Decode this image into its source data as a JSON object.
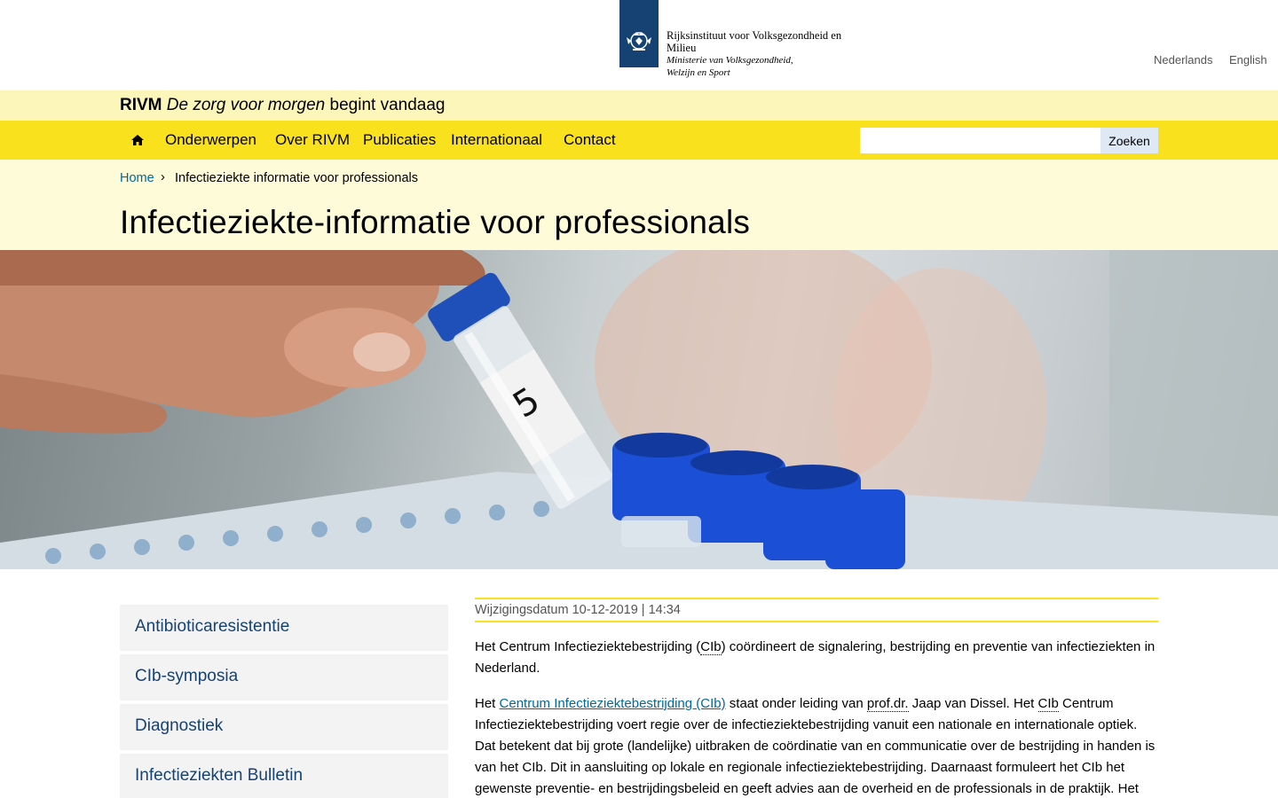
{
  "header": {
    "org_name": "Rijksinstituut voor Volksgezondheid en Milieu",
    "ministry": "Ministerie van Volksgezondheid, Welzijn en Sport",
    "languages": [
      "Nederlands",
      "English"
    ],
    "logo_color": "#154273"
  },
  "slogan": {
    "brand": "RIVM",
    "italic": "De zorg voor morgen",
    "rest": "begint vandaag"
  },
  "nav": {
    "home_icon": "home-icon",
    "items": [
      "Onderwerpen",
      "Over RIVM",
      "Publicaties",
      "Internationaal",
      "Contact"
    ],
    "search_placeholder": "",
    "search_button": "Zoeken",
    "color": "#f9e11e"
  },
  "breadcrumb": {
    "home": "Home",
    "separator": "›",
    "current": "Infectieziekte informatie voor professionals"
  },
  "page": {
    "title": "Infectieziekte-informatie voor professionals"
  },
  "sidebar": {
    "items": [
      "Antibioticaresistentie",
      "CIb-symposia",
      "Diagnostiek",
      "Infectieziekten Bulletin"
    ]
  },
  "content": {
    "meta": "Wijzigingsdatum 10-12-2019 | 14:34",
    "p1_a": "Het Centrum Infectieziektebestrijding (",
    "p1_abbr": "CIb",
    "p1_b": ") coördineert de signalering, bestrijding en preventie van infectieziekten in Nederland.",
    "p2_a": "Het ",
    "p2_link": "Centrum Infectieziektebestrijding (CIb)",
    "p2_b": " staat onder leiding van ",
    "p2_abbr1": "prof.dr.",
    "p2_c": " Jaap van Dissel. Het ",
    "p2_abbr2": "CIb",
    "p2_d": " Centrum Infectieziektebestrijding  voert regie over de infectieziektebestrijding vanuit een nationale en internationale optiek. Dat betekent dat bij grote (landelijke) uitbraken de coördinatie van en communicatie over de bestrijding in handen is van het CIb. Dit in aansluiting op lokale en regionale infectieziektebestrijding. Daarnaast formuleert het CIb het gewenste preventie- en bestrijdingsbeleid en geeft advies aan de overheid en de professionals in de praktijk. Het"
  }
}
